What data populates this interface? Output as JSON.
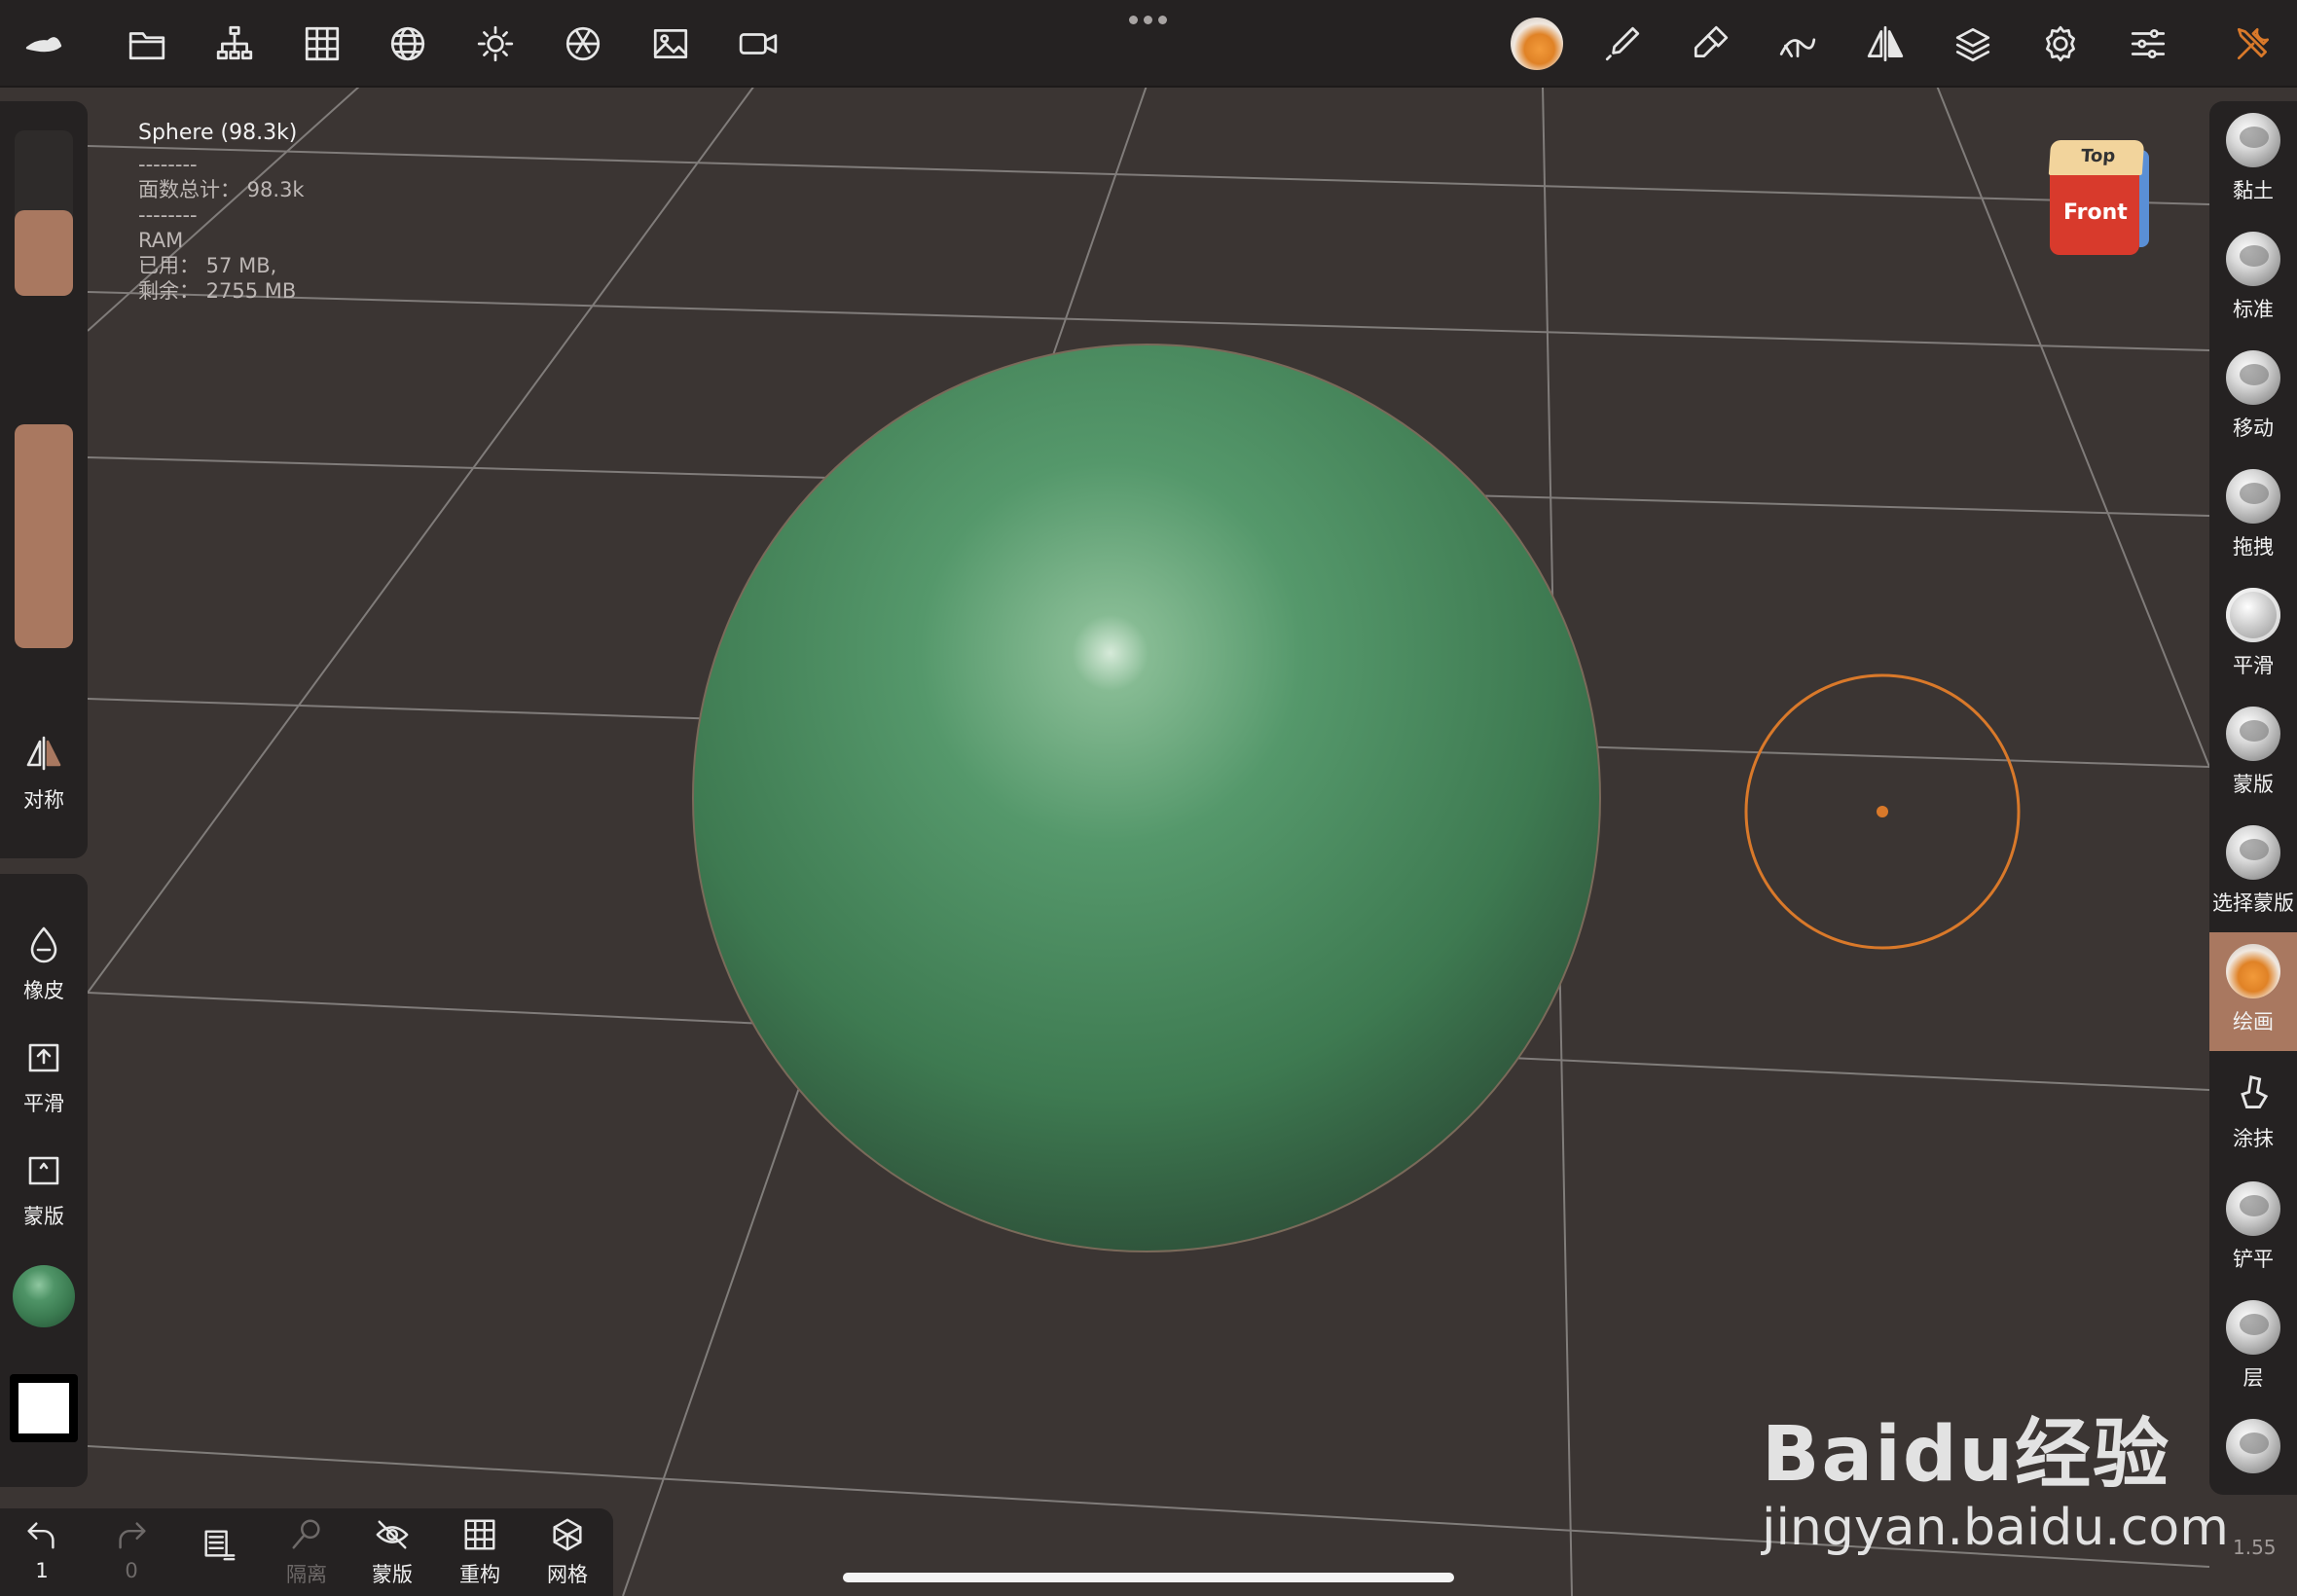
{
  "info": {
    "title": "Sphere (98.3k)",
    "sep1": "--------",
    "faces": "面数总计： 98.3k",
    "sep2": "--------",
    "ram": "RAM",
    "used": "已用： 57 MB,",
    "free": "剩余： 2755 MB"
  },
  "left": {
    "symmetry": "对称",
    "eraser": "橡皮",
    "smooth": "平滑",
    "mask": "蒙版",
    "radius_level": 0.52,
    "intensity_level": 1.0
  },
  "bottom": {
    "undo_count": "1",
    "redo_count": "0",
    "isolate": "隔离",
    "mask": "蒙版",
    "remesh": "重构",
    "mesh": "网格"
  },
  "right_tools": [
    {
      "label": "黏土"
    },
    {
      "label": "标准"
    },
    {
      "label": "移动"
    },
    {
      "label": "拖拽"
    },
    {
      "label": "平滑"
    },
    {
      "label": "蒙版"
    },
    {
      "label": "选择蒙版"
    },
    {
      "label": "绘画"
    },
    {
      "label": "涂抹"
    },
    {
      "label": "铲平"
    },
    {
      "label": "层"
    }
  ],
  "cube": {
    "top": "Top",
    "front": "Front"
  },
  "version": "1.55",
  "watermark": {
    "brand": "Baidu经验",
    "url": "jingyan.baidu.com"
  },
  "colors": {
    "accent": "#a97860",
    "sphere": "#4f9467",
    "brush_ring": "#d9792a",
    "panel": "#252222",
    "background": "#3b3533"
  }
}
